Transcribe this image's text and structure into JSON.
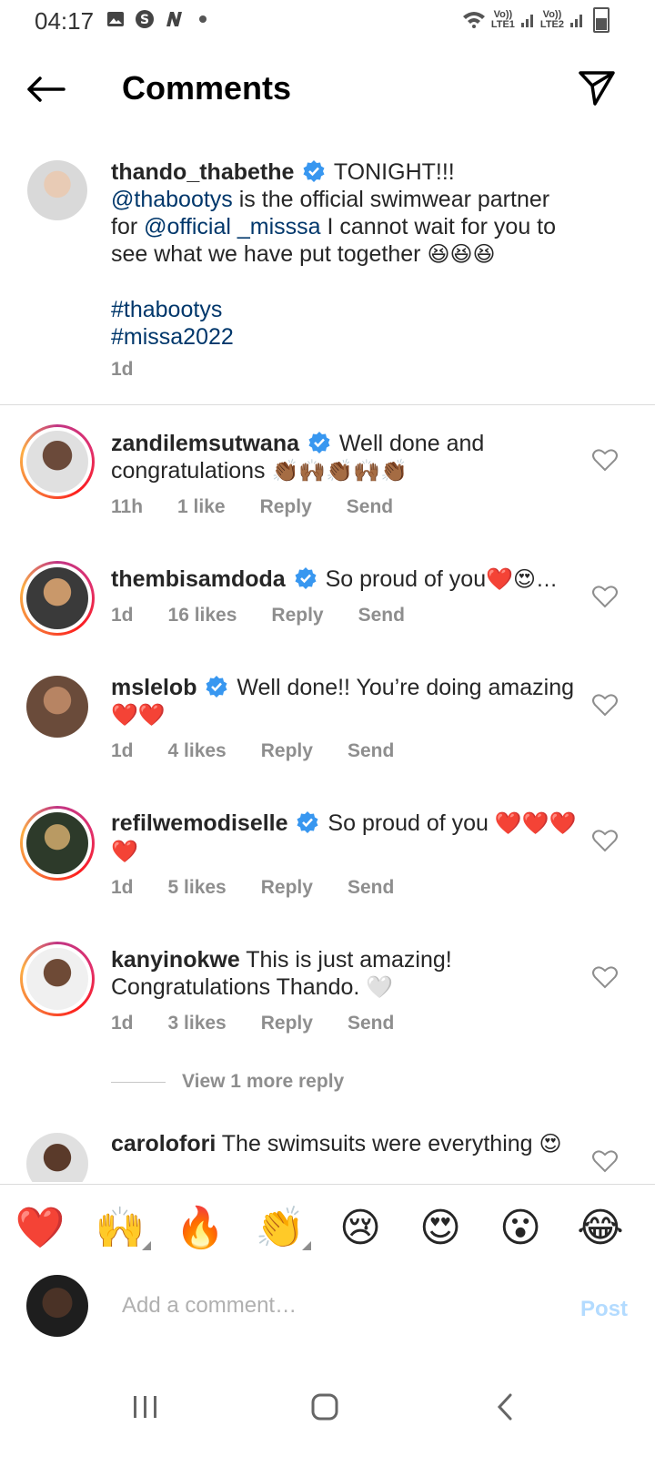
{
  "status": {
    "time": "04:17",
    "net1_top": "Vo))",
    "net1_bottom": "LTE1",
    "net2_top": "Vo))",
    "net2_bottom": "LTE2"
  },
  "header": {
    "title": "Comments"
  },
  "post": {
    "username": "thando_thabethe",
    "text_1": " TONIGHT!!! ",
    "mention_1": "@thabootys",
    "text_2": " is the official swimwear partner for ",
    "mention_2": "@official _misssa",
    "text_3": " I cannot wait for you to see what we have put together ",
    "emoji": "😆😆😆",
    "hashtag_1": "#thabootys",
    "hashtag_2": "#missa2022",
    "time": "1d"
  },
  "comments": [
    {
      "username": "zandilemsutwana",
      "verified": true,
      "text": " Well done and congratulations ",
      "emoji": "👏🏾🙌🏾👏🏾🙌🏾👏🏾",
      "time": "11h",
      "likes": "1 like",
      "reply": "Reply",
      "send": "Send"
    },
    {
      "username": "thembisamdoda",
      "verified": true,
      "text": " So proud of you",
      "emoji": "❤️😍…",
      "time": "1d",
      "likes": "16 likes",
      "reply": "Reply",
      "send": "Send"
    },
    {
      "username": "mslelob",
      "verified": true,
      "text": " Well done!! You’re doing amazing ",
      "emoji": "❤️❤️",
      "time": "1d",
      "likes": "4 likes",
      "reply": "Reply",
      "send": "Send"
    },
    {
      "username": "refilwemodiselle",
      "verified": true,
      "text": " So proud of you ",
      "emoji": "❤️❤️❤️❤️",
      "time": "1d",
      "likes": "5 likes",
      "reply": "Reply",
      "send": "Send"
    },
    {
      "username": "kanyinokwe",
      "verified": false,
      "text": " This is just amazing! Congratulations Thando. ",
      "emoji": "🤍",
      "time": "1d",
      "likes": "3 likes",
      "reply": "Reply",
      "send": "Send"
    },
    {
      "username": "carolofori",
      "verified": false,
      "text": " The swimsuits were everything ",
      "emoji": "😍"
    }
  ],
  "view_more_reply": "View 1 more reply",
  "reactions": [
    "❤️",
    "🙌",
    "🔥",
    "👏",
    "😢",
    "😍",
    "😮",
    "😂"
  ],
  "composer": {
    "placeholder": "Add a comment…",
    "post_label": "Post"
  },
  "colors": {
    "link": "#00376b",
    "verified": "#3897f0",
    "post_disabled": "#b3dbff"
  }
}
